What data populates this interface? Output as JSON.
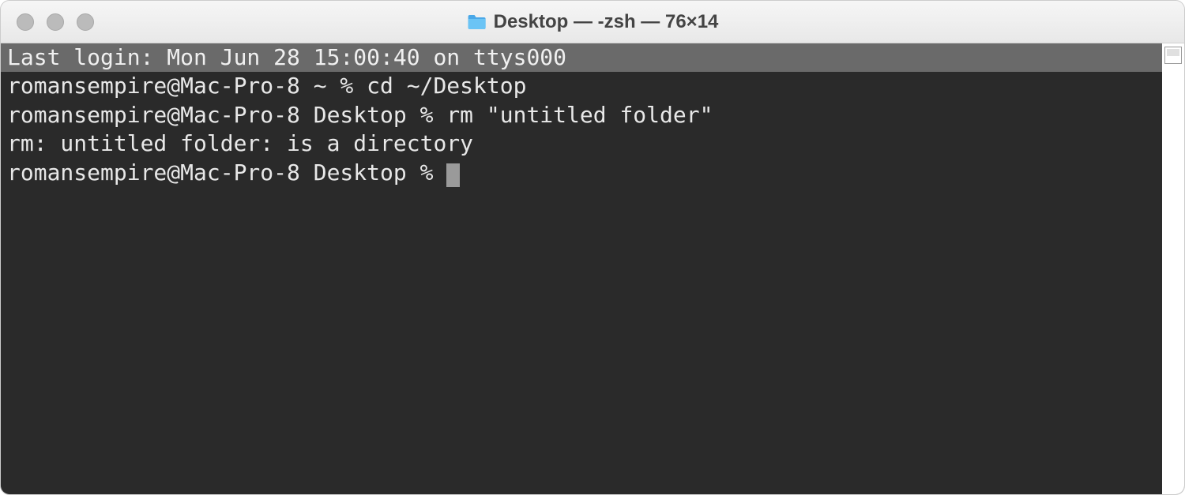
{
  "window": {
    "title": "Desktop — -zsh — 76×14"
  },
  "terminal": {
    "lines": [
      "Last login: Mon Jun 28 15:00:40 on ttys000",
      "romansempire@Mac-Pro-8 ~ % cd ~/Desktop",
      "romansempire@Mac-Pro-8 Desktop % rm \"untitled folder\"",
      "rm: untitled folder: is a directory",
      "romansempire@Mac-Pro-8 Desktop % "
    ]
  }
}
